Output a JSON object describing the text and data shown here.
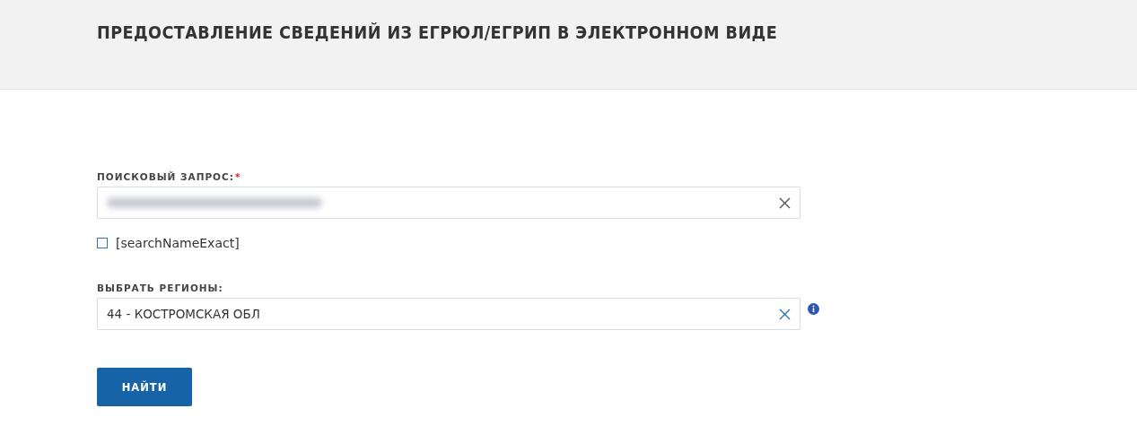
{
  "header": {
    "title": "ПРЕДОСТАВЛЕНИЕ СВЕДЕНИЙ ИЗ ЕГРЮЛ/ЕГРИП В ЭЛЕКТРОННОМ ВИДЕ"
  },
  "search_query": {
    "label": "ПОИСКОВЫЙ ЗАПРОС:",
    "required_mark": "*",
    "value_redacted": true
  },
  "exact_checkbox": {
    "label": "[searchNameExact]",
    "checked": false
  },
  "regions": {
    "label": "ВЫБРАТЬ РЕГИОНЫ:",
    "value": "44 - КОСТРОМСКАЯ ОБЛ"
  },
  "submit_button": {
    "label": "НАЙТИ"
  }
}
